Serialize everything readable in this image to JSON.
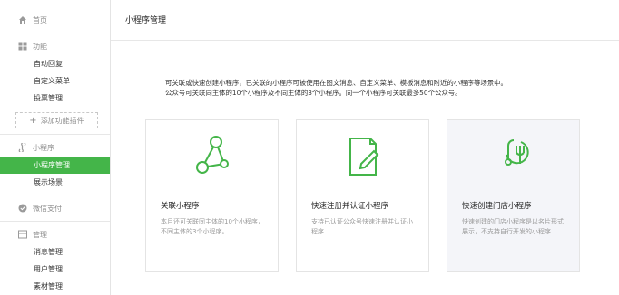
{
  "sidebar": {
    "home": "首页",
    "function_group": "功能",
    "function_items": [
      "自动回复",
      "自定义菜单",
      "投票管理"
    ],
    "add_plugin": "添加功能插件",
    "miniprogram_group": "小程序",
    "miniprogram_items": [
      "小程序管理",
      "展示场景"
    ],
    "wechat_pay": "微信支付",
    "manage_group": "管理",
    "manage_items": [
      "消息管理",
      "用户管理",
      "素材管理"
    ]
  },
  "main": {
    "title": "小程序管理",
    "description_line1": "可关联或快速创建小程序，已关联的小程序可被使用在图文消息、自定义菜单、模板消息和附近的小程序等场景中。",
    "description_line2": "公众号可关联同主体的10个小程序及不同主体的3个小程序。同一个小程序可关联最多50个公众号。",
    "cards": [
      {
        "title": "关联小程序",
        "desc": "本月还可关联同主体的10个小程序，不同主体的3个小程序。"
      },
      {
        "title": "快速注册并认证小程序",
        "desc": "支持已认证公众号快速注册并认证小程序"
      },
      {
        "title": "快速创建门店小程序",
        "desc": "快速创建的门店小程序是以名片形式展示，不支持自行开发的小程序"
      }
    ]
  },
  "colors": {
    "accent": "#44b549",
    "sidebar_bg": "#ffffff",
    "card_highlight": "#f4f5f9"
  }
}
